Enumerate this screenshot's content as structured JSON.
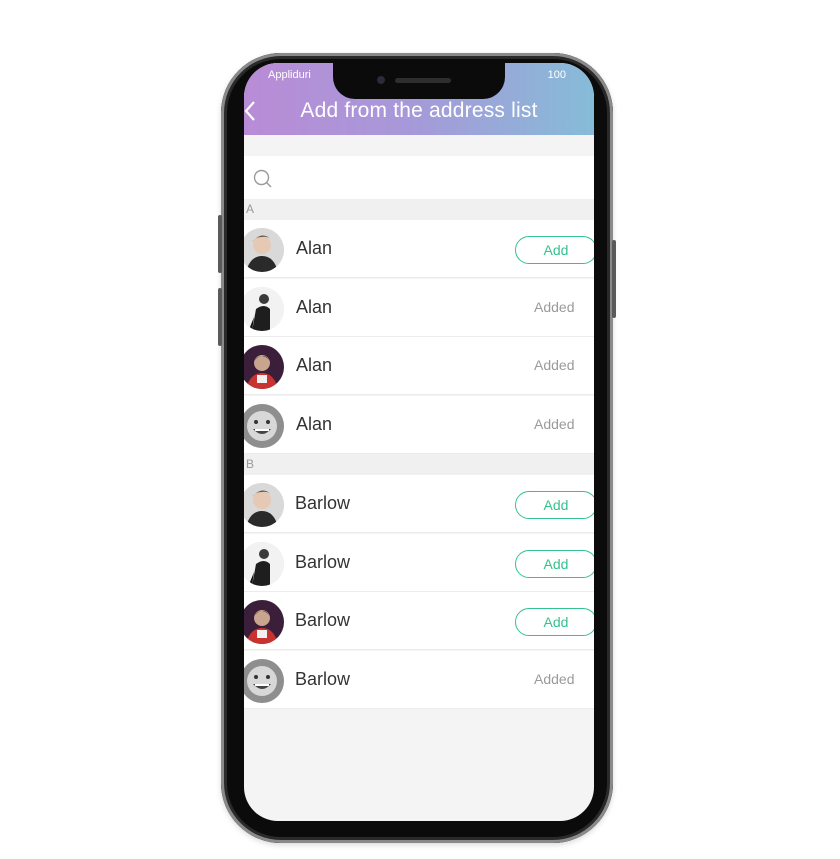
{
  "status": {
    "carrier": "Appliduri",
    "battery": "100"
  },
  "header": {
    "title": "Add from the address list"
  },
  "search": {
    "placeholder": ""
  },
  "sections": [
    {
      "letter": "A",
      "contacts": [
        {
          "name": "Alan",
          "action": "Add",
          "state": "add",
          "avatar": "young-man-avatar"
        },
        {
          "name": "Alan",
          "action": "Added",
          "state": "added",
          "avatar": "man-in-suit-avatar"
        },
        {
          "name": "Alan",
          "action": "Added",
          "state": "added",
          "avatar": "person-red-jacket-avatar"
        },
        {
          "name": "Alan",
          "action": "Added",
          "state": "added",
          "avatar": "grinning-face-avatar"
        }
      ]
    },
    {
      "letter": "B",
      "contacts": [
        {
          "name": "Barlow",
          "action": "Add",
          "state": "add",
          "avatar": "young-man-avatar"
        },
        {
          "name": "Barlow",
          "action": "Add",
          "state": "add",
          "avatar": "man-in-suit-avatar"
        },
        {
          "name": "Barlow",
          "action": "Add",
          "state": "add",
          "avatar": "person-red-jacket-avatar"
        },
        {
          "name": "Barlow",
          "action": "Added",
          "state": "added",
          "avatar": "grinning-face-avatar"
        }
      ]
    }
  ],
  "colors": {
    "accent": "#34c28e",
    "header_start": "#b98bd6",
    "header_end": "#86bcd8",
    "muted": "#9a9a9a"
  }
}
